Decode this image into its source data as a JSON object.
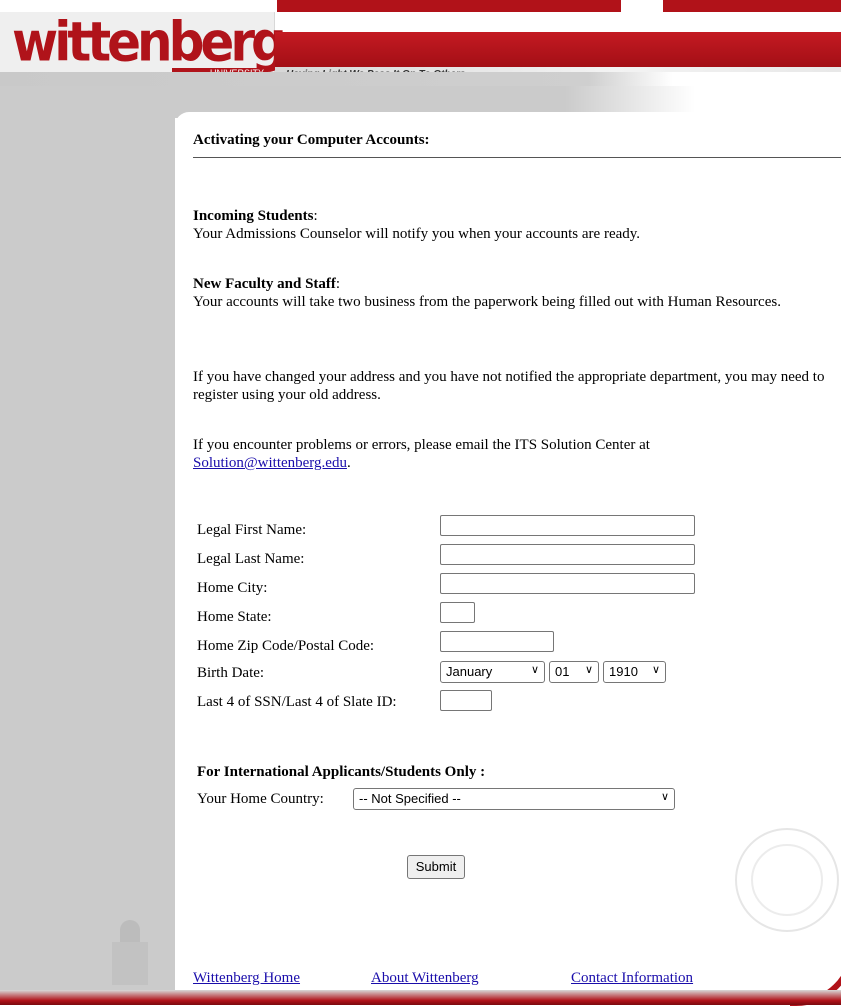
{
  "colors": {
    "brand_red": "#b11219",
    "link_blue": "#1a0dab",
    "frame_gray": "#cbcbcb"
  },
  "header": {
    "logo_text": "wittenberg",
    "logo_subtext": "UNIVERSITY",
    "tagline": "Having Light We Pass It On To Others"
  },
  "main": {
    "title": "Activating your Computer Accounts:",
    "incoming_heading": "Incoming Students",
    "incoming_text": "Your Admissions Counselor will notify you when your accounts are ready.",
    "faculty_heading": "New Faculty and Staff",
    "faculty_text": "Your accounts will take two business from the paperwork being filled out with Human Resources.",
    "address_note": "If you have changed your address and you have not notified the appropriate department, you may need to register using your old address.",
    "problems_note": "If you encounter problems or errors, please email the ITS Solution Center at",
    "email_link": "Solution@wittenberg.edu"
  },
  "form": {
    "first_name_label": "Legal First Name:",
    "last_name_label": "Legal Last Name:",
    "city_label": "Home City:",
    "state_label": "Home State:",
    "zip_label": "Home Zip Code/Postal Code:",
    "birth_label": "Birth Date:",
    "birth_month": "January",
    "birth_day": "01",
    "birth_year": "1910",
    "ssn_label": "Last 4 of SSN/Last 4 of Slate ID:",
    "intl_heading": "For International Applicants/Students Only :",
    "country_label": "Your Home Country:",
    "country_value": "-- Not Specified --",
    "submit_label": "Submit"
  },
  "footer": {
    "home": "Wittenberg Home",
    "about": "About Wittenberg",
    "contact": "Contact Information"
  }
}
